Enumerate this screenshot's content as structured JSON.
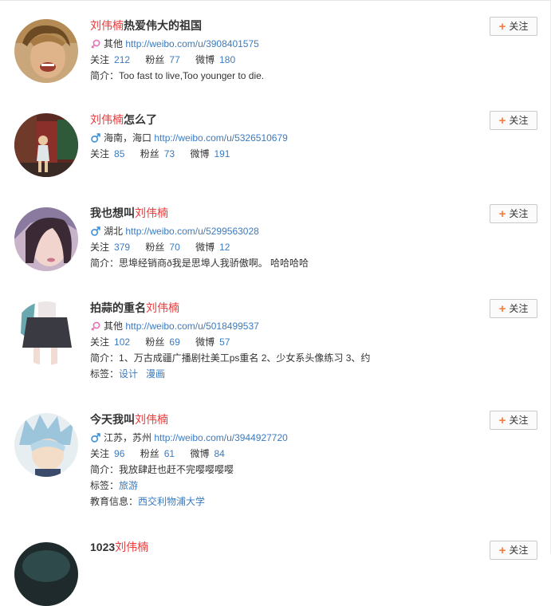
{
  "follow_label": "关注",
  "users": [
    {
      "name_highlight": "刘伟楠",
      "name_rest": "热爱伟大的祖国",
      "location": "其他",
      "url": "http://weibo.com/u/3908401575",
      "follow_label": "关注",
      "follow_count": "212",
      "fans_label": "粉丝",
      "fans_count": "77",
      "weibo_label": "微博",
      "weibo_count": "180",
      "bio_label": "简介：",
      "bio": "Too fast to live,Too younger to die."
    },
    {
      "name_highlight": "刘伟楠",
      "name_rest": "怎么了",
      "location": "海南，海口",
      "url": "http://weibo.com/u/5326510679",
      "follow_label": "关注",
      "follow_count": "85",
      "fans_label": "粉丝",
      "fans_count": "73",
      "weibo_label": "微博",
      "weibo_count": "191"
    },
    {
      "name_prefix": "我也想叫",
      "name_highlight": "刘伟楠",
      "location": "湖北",
      "url": "http://weibo.com/u/5299563028",
      "follow_label": "关注",
      "follow_count": "379",
      "fans_label": "粉丝",
      "fans_count": "70",
      "weibo_label": "微博",
      "weibo_count": "12",
      "bio_label": "简介：",
      "bio": "思埠经销商ð我是思埠人我骄傲啊。 哈哈哈哈"
    },
    {
      "name_prefix": "拍蒜的重名",
      "name_highlight": "刘伟楠",
      "location": "其他",
      "url": "http://weibo.com/u/5018499537",
      "follow_label": "关注",
      "follow_count": "102",
      "fans_label": "粉丝",
      "fans_count": "69",
      "weibo_label": "微博",
      "weibo_count": "57",
      "bio_label": "简介：",
      "bio": "1、万古成疆广播剧社美工ps重名 2、少女系头像练习 3、约",
      "tags_label": "标签：",
      "tags": [
        "设计",
        "漫画"
      ]
    },
    {
      "name_prefix": "今天我叫",
      "name_highlight": "刘伟楠",
      "location": "江苏，苏州",
      "url": "http://weibo.com/u/3944927720",
      "follow_label": "关注",
      "follow_count": "96",
      "fans_label": "粉丝",
      "fans_count": "61",
      "weibo_label": "微博",
      "weibo_count": "84",
      "bio_label": "简介：",
      "bio": "我放肆赶也赶不完嘤嘤嘤嘤",
      "tags_label": "标签：",
      "tags": [
        "旅游"
      ],
      "edu_label": "教育信息：",
      "edu": "西交利物浦大学"
    },
    {
      "name_prefix": "1023",
      "name_highlight": "刘伟楠"
    }
  ],
  "colors": {
    "highlight": "#eb3a3a",
    "link": "#3b7bbf",
    "female": "#e870b4",
    "male": "#3a8fd8",
    "plus": "#f77c3d"
  }
}
